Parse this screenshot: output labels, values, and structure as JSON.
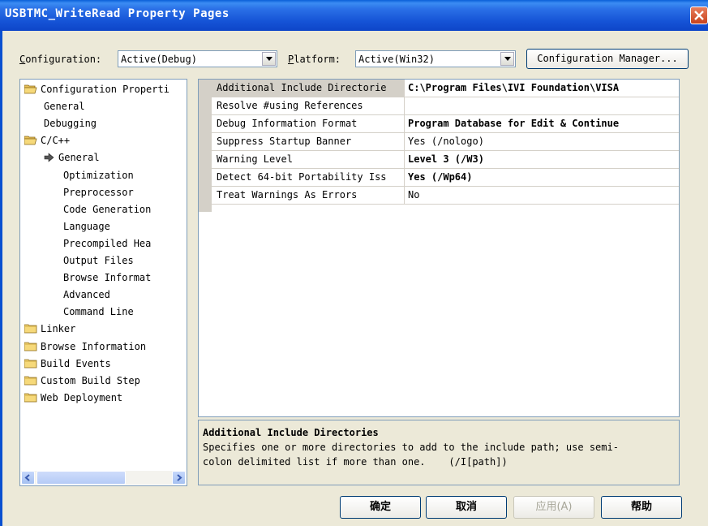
{
  "window": {
    "title": "USBTMC_WriteRead Property Pages"
  },
  "toolbar": {
    "configuration_label": "Configuration:",
    "configuration_value": "Active(Debug)",
    "platform_label": "Platform:",
    "platform_value": "Active(Win32)",
    "config_manager_label": "Configuration Manager..."
  },
  "tree": {
    "items": [
      {
        "label": "Configuration Properti",
        "type": "folder-open"
      },
      {
        "label": "General",
        "type": "leaf"
      },
      {
        "label": "Debugging",
        "type": "leaf"
      },
      {
        "label": "C/C++",
        "type": "folder-open"
      },
      {
        "label": "General",
        "type": "leaf",
        "selected": true
      },
      {
        "label": "Optimization",
        "type": "leaf"
      },
      {
        "label": "Preprocessor",
        "type": "leaf"
      },
      {
        "label": "Code Generation",
        "type": "leaf"
      },
      {
        "label": "Language",
        "type": "leaf"
      },
      {
        "label": "Precompiled Hea",
        "type": "leaf"
      },
      {
        "label": "Output Files",
        "type": "leaf"
      },
      {
        "label": "Browse Informat",
        "type": "leaf"
      },
      {
        "label": "Advanced",
        "type": "leaf"
      },
      {
        "label": "Command Line",
        "type": "leaf"
      },
      {
        "label": "Linker",
        "type": "folder"
      },
      {
        "label": "Browse Information",
        "type": "folder"
      },
      {
        "label": "Build Events",
        "type": "folder"
      },
      {
        "label": "Custom Build Step",
        "type": "folder"
      },
      {
        "label": "Web Deployment",
        "type": "folder"
      }
    ]
  },
  "grid": {
    "rows": [
      {
        "name": "Additional Include Directorie",
        "value": "C:\\Program Files\\IVI Foundation\\VISA",
        "bold": true
      },
      {
        "name": "Resolve #using References",
        "value": "",
        "bold": false
      },
      {
        "name": "Debug Information Format",
        "value": "Program Database for Edit & Continue",
        "bold": true
      },
      {
        "name": "Suppress Startup Banner",
        "value": "Yes (/nologo)",
        "bold": false
      },
      {
        "name": "Warning Level",
        "value": "Level 3 (/W3)",
        "bold": true
      },
      {
        "name": "Detect 64-bit Portability Iss",
        "value": "Yes (/Wp64)",
        "bold": true
      },
      {
        "name": "Treat Warnings As Errors",
        "value": "No",
        "bold": false
      }
    ]
  },
  "description": {
    "title": "Additional Include Directories",
    "line1": "Specifies one or more directories to add to the include path; use semi-",
    "line2": "colon delimited list if more than one.    (/I[path])"
  },
  "buttons": {
    "ok": "确定",
    "cancel": "取消",
    "apply": "应用(A)",
    "help": "帮助"
  },
  "icons": [
    "close-icon",
    "dropdown-arrow-icon",
    "folder-icon",
    "folder-open-icon",
    "arrow-right-icon",
    "scroll-left-icon",
    "scroll-right-icon"
  ]
}
